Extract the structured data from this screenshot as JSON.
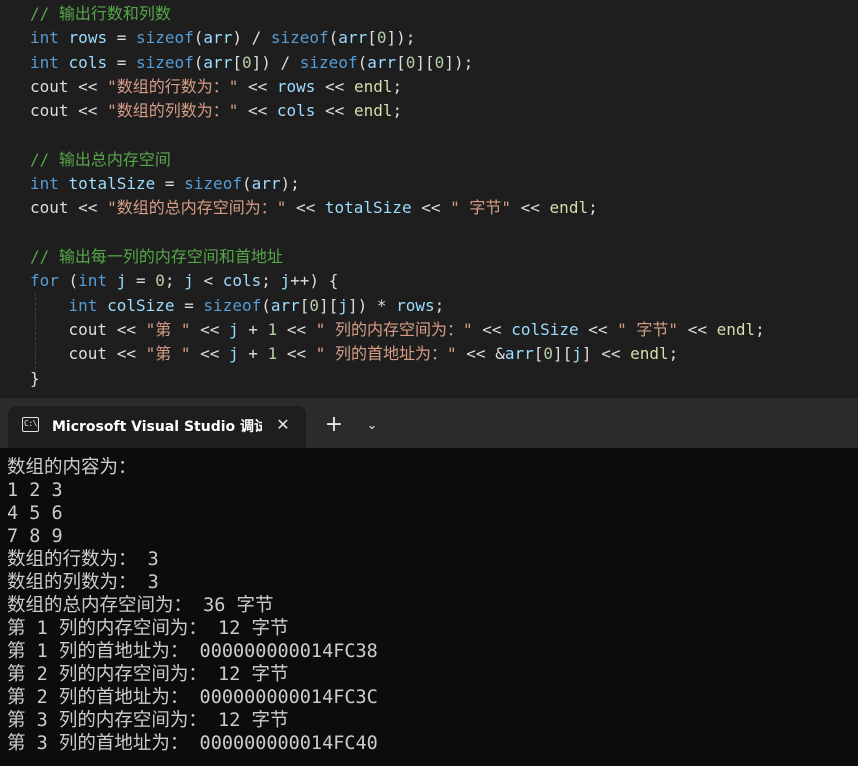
{
  "editor": {
    "lines": [
      [
        {
          "t": "// 输出行数和列数",
          "c": "cmt"
        }
      ],
      [
        {
          "t": "int",
          "c": "kw"
        },
        {
          "t": " ",
          "c": "txt"
        },
        {
          "t": "rows",
          "c": "id"
        },
        {
          "t": " = ",
          "c": "txt"
        },
        {
          "t": "sizeof",
          "c": "kw"
        },
        {
          "t": "(",
          "c": "txt"
        },
        {
          "t": "arr",
          "c": "id"
        },
        {
          "t": ") / ",
          "c": "txt"
        },
        {
          "t": "sizeof",
          "c": "kw"
        },
        {
          "t": "(",
          "c": "txt"
        },
        {
          "t": "arr",
          "c": "id"
        },
        {
          "t": "[",
          "c": "txt"
        },
        {
          "t": "0",
          "c": "num"
        },
        {
          "t": "]);",
          "c": "txt"
        }
      ],
      [
        {
          "t": "int",
          "c": "kw"
        },
        {
          "t": " ",
          "c": "txt"
        },
        {
          "t": "cols",
          "c": "id"
        },
        {
          "t": " = ",
          "c": "txt"
        },
        {
          "t": "sizeof",
          "c": "kw"
        },
        {
          "t": "(",
          "c": "txt"
        },
        {
          "t": "arr",
          "c": "id"
        },
        {
          "t": "[",
          "c": "txt"
        },
        {
          "t": "0",
          "c": "num"
        },
        {
          "t": "]) / ",
          "c": "txt"
        },
        {
          "t": "sizeof",
          "c": "kw"
        },
        {
          "t": "(",
          "c": "txt"
        },
        {
          "t": "arr",
          "c": "id"
        },
        {
          "t": "[",
          "c": "txt"
        },
        {
          "t": "0",
          "c": "num"
        },
        {
          "t": "][",
          "c": "txt"
        },
        {
          "t": "0",
          "c": "num"
        },
        {
          "t": "]);",
          "c": "txt"
        }
      ],
      [
        {
          "t": "cout",
          "c": "txt"
        },
        {
          "t": " << ",
          "c": "txt"
        },
        {
          "t": "\"数组的行数为：\"",
          "c": "str"
        },
        {
          "t": " << ",
          "c": "txt"
        },
        {
          "t": "rows",
          "c": "id"
        },
        {
          "t": " << ",
          "c": "txt"
        },
        {
          "t": "endl",
          "c": "fn"
        },
        {
          "t": ";",
          "c": "txt"
        }
      ],
      [
        {
          "t": "cout",
          "c": "txt"
        },
        {
          "t": " << ",
          "c": "txt"
        },
        {
          "t": "\"数组的列数为：\"",
          "c": "str"
        },
        {
          "t": " << ",
          "c": "txt"
        },
        {
          "t": "cols",
          "c": "id"
        },
        {
          "t": " << ",
          "c": "txt"
        },
        {
          "t": "endl",
          "c": "fn"
        },
        {
          "t": ";",
          "c": "txt"
        }
      ],
      [],
      [
        {
          "t": "// 输出总内存空间",
          "c": "cmt"
        }
      ],
      [
        {
          "t": "int",
          "c": "kw"
        },
        {
          "t": " ",
          "c": "txt"
        },
        {
          "t": "totalSize",
          "c": "id"
        },
        {
          "t": " = ",
          "c": "txt"
        },
        {
          "t": "sizeof",
          "c": "kw"
        },
        {
          "t": "(",
          "c": "txt"
        },
        {
          "t": "arr",
          "c": "id"
        },
        {
          "t": ");",
          "c": "txt"
        }
      ],
      [
        {
          "t": "cout",
          "c": "txt"
        },
        {
          "t": " << ",
          "c": "txt"
        },
        {
          "t": "\"数组的总内存空间为：\"",
          "c": "str"
        },
        {
          "t": " << ",
          "c": "txt"
        },
        {
          "t": "totalSize",
          "c": "id"
        },
        {
          "t": " << ",
          "c": "txt"
        },
        {
          "t": "\" 字节\"",
          "c": "str"
        },
        {
          "t": " << ",
          "c": "txt"
        },
        {
          "t": "endl",
          "c": "fn"
        },
        {
          "t": ";",
          "c": "txt"
        }
      ],
      [],
      [
        {
          "t": "// 输出每一列的内存空间和首地址",
          "c": "cmt"
        }
      ],
      [
        {
          "t": "for",
          "c": "kw"
        },
        {
          "t": " (",
          "c": "txt"
        },
        {
          "t": "int",
          "c": "kw"
        },
        {
          "t": " ",
          "c": "txt"
        },
        {
          "t": "j",
          "c": "id"
        },
        {
          "t": " = ",
          "c": "txt"
        },
        {
          "t": "0",
          "c": "num"
        },
        {
          "t": "; ",
          "c": "txt"
        },
        {
          "t": "j",
          "c": "id"
        },
        {
          "t": " < ",
          "c": "txt"
        },
        {
          "t": "cols",
          "c": "id"
        },
        {
          "t": "; ",
          "c": "txt"
        },
        {
          "t": "j",
          "c": "id"
        },
        {
          "t": "++) {",
          "c": "txt"
        }
      ],
      [
        {
          "t": "    ",
          "c": "txt"
        },
        {
          "t": "int",
          "c": "kw"
        },
        {
          "t": " ",
          "c": "txt"
        },
        {
          "t": "colSize",
          "c": "id"
        },
        {
          "t": " = ",
          "c": "txt"
        },
        {
          "t": "sizeof",
          "c": "kw"
        },
        {
          "t": "(",
          "c": "txt"
        },
        {
          "t": "arr",
          "c": "id"
        },
        {
          "t": "[",
          "c": "txt"
        },
        {
          "t": "0",
          "c": "num"
        },
        {
          "t": "][",
          "c": "txt"
        },
        {
          "t": "j",
          "c": "id"
        },
        {
          "t": "]) * ",
          "c": "txt"
        },
        {
          "t": "rows",
          "c": "id"
        },
        {
          "t": ";",
          "c": "txt"
        }
      ],
      [
        {
          "t": "    cout",
          "c": "txt"
        },
        {
          "t": " << ",
          "c": "txt"
        },
        {
          "t": "\"第 \"",
          "c": "str"
        },
        {
          "t": " << ",
          "c": "txt"
        },
        {
          "t": "j",
          "c": "id"
        },
        {
          "t": " + ",
          "c": "txt"
        },
        {
          "t": "1",
          "c": "num"
        },
        {
          "t": " << ",
          "c": "txt"
        },
        {
          "t": "\" 列的内存空间为：\"",
          "c": "str"
        },
        {
          "t": " << ",
          "c": "txt"
        },
        {
          "t": "colSize",
          "c": "id"
        },
        {
          "t": " << ",
          "c": "txt"
        },
        {
          "t": "\" 字节\"",
          "c": "str"
        },
        {
          "t": " << ",
          "c": "txt"
        },
        {
          "t": "endl",
          "c": "fn"
        },
        {
          "t": ";",
          "c": "txt"
        }
      ],
      [
        {
          "t": "    cout",
          "c": "txt"
        },
        {
          "t": " << ",
          "c": "txt"
        },
        {
          "t": "\"第 \"",
          "c": "str"
        },
        {
          "t": " << ",
          "c": "txt"
        },
        {
          "t": "j",
          "c": "id"
        },
        {
          "t": " + ",
          "c": "txt"
        },
        {
          "t": "1",
          "c": "num"
        },
        {
          "t": " << ",
          "c": "txt"
        },
        {
          "t": "\" 列的首地址为：\"",
          "c": "str"
        },
        {
          "t": " << &",
          "c": "txt"
        },
        {
          "t": "arr",
          "c": "id"
        },
        {
          "t": "[",
          "c": "txt"
        },
        {
          "t": "0",
          "c": "num"
        },
        {
          "t": "][",
          "c": "txt"
        },
        {
          "t": "j",
          "c": "id"
        },
        {
          "t": "] << ",
          "c": "txt"
        },
        {
          "t": "endl",
          "c": "fn"
        },
        {
          "t": ";",
          "c": "txt"
        }
      ],
      [
        {
          "t": "}",
          "c": "txt"
        }
      ]
    ]
  },
  "terminal": {
    "tab_icon_text": "C:\\",
    "tab_title": "Microsoft Visual Studio 调试控",
    "close_glyph": "✕",
    "new_tab_glyph": "+",
    "dropdown_glyph": "⌄",
    "output_lines": [
      "数组的内容为：",
      "1 2 3",
      "4 5 6",
      "7 8 9",
      "数组的行数为： 3",
      "数组的列数为： 3",
      "数组的总内存空间为： 36 字节",
      "第 1 列的内存空间为： 12 字节",
      "第 1 列的首地址为： 000000000014FC38",
      "第 2 列的内存空间为： 12 字节",
      "第 2 列的首地址为： 000000000014FC3C",
      "第 3 列的内存空间为： 12 字节",
      "第 3 列的首地址为： 000000000014FC40"
    ]
  },
  "colors": {
    "keyword": "#569cd6",
    "identifier": "#9cdcfe",
    "function": "#dcdcaa",
    "number": "#b5cea8",
    "string": "#d69d85",
    "comment": "#57a64a",
    "plain": "#dcdcdc",
    "editor_bg": "#1e1e1e",
    "terminal_bg": "#0c0c0c"
  }
}
